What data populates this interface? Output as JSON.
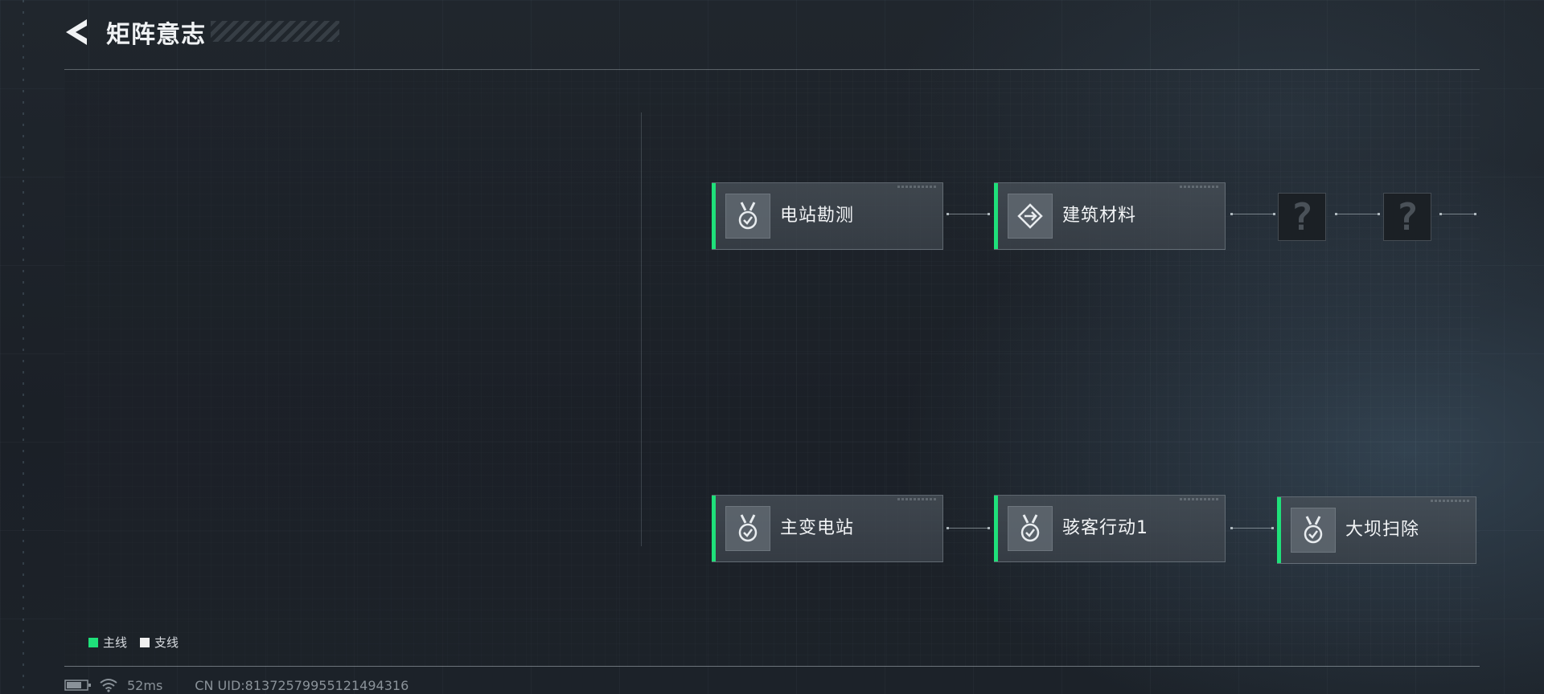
{
  "header": {
    "title": "矩阵意志",
    "back_icon": "back-arrow-icon"
  },
  "missions": {
    "main_row": [
      {
        "label": "电站勘测",
        "icon": "medal-check-icon",
        "line": "main"
      },
      {
        "label": "建筑材料",
        "icon": "diamond-arrow-icon",
        "line": "main"
      },
      {
        "label": "?",
        "icon": "locked-question-icon",
        "locked": true
      },
      {
        "label": "?",
        "icon": "locked-question-icon",
        "locked": true
      }
    ],
    "second_row": [
      {
        "label": "主变电站",
        "icon": "medal-check-icon",
        "line": "main"
      },
      {
        "label": "骇客行动1",
        "icon": "medal-check-icon",
        "line": "main"
      },
      {
        "label": "大坝扫除",
        "icon": "medal-check-icon",
        "line": "main"
      }
    ]
  },
  "legend": {
    "main_label": "主线",
    "side_label": "支线",
    "main_color": "#1fe07a",
    "side_color": "#f0f0f0"
  },
  "status_bar": {
    "ping": "52ms",
    "uid": "CN UID:813725799551214943​16"
  }
}
